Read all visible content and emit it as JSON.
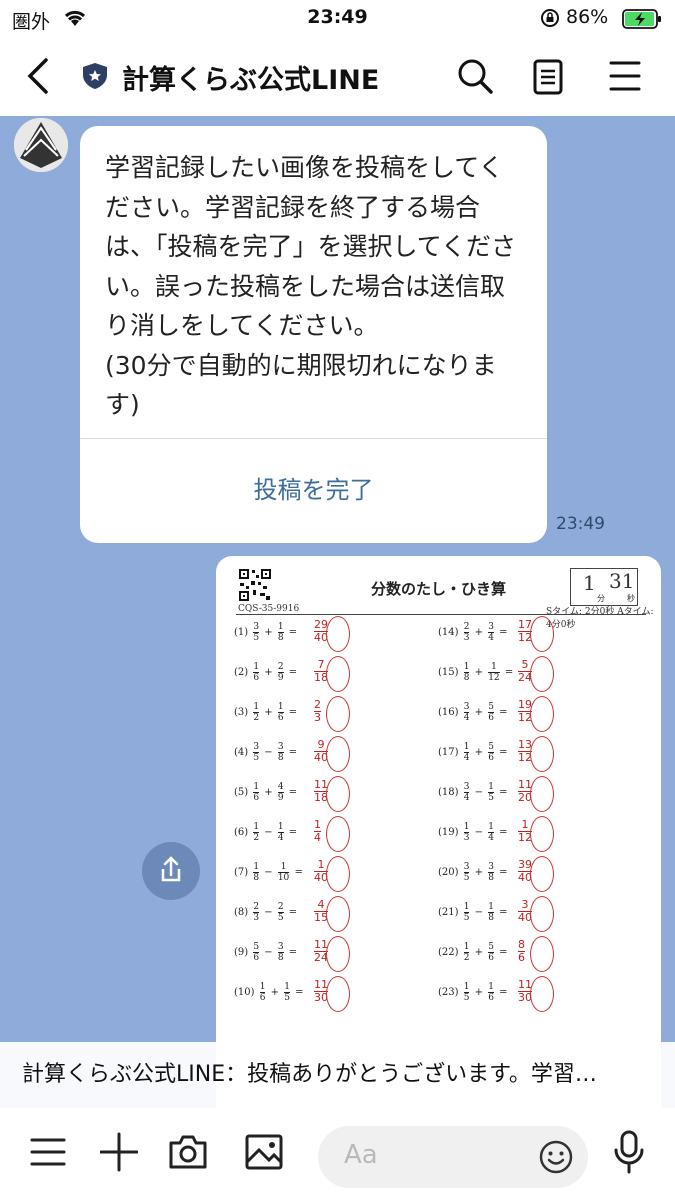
{
  "status": {
    "carrier": "圏外",
    "time": "23:49",
    "battery": "86%"
  },
  "header": {
    "title": "計算くらぶ公式LINE"
  },
  "message": {
    "text": "学習記録したい画像を投稿をしてください。学習記録を終了する場合は、「投稿を完了」を選択してください。誤った投稿をした場合は送信取り消しをしてください。\n(30分で自動的に期限切れになります)",
    "action_label": "投稿を完了",
    "time": "23:49"
  },
  "worksheet": {
    "title": "分数のたし・ひき算",
    "code": "CQS-35-9916",
    "meta": "Sタイム: 2分0秒  Aタイム: 4分0秒",
    "time_min": "1",
    "time_sec": "31",
    "min_label": "分",
    "sec_label": "秒",
    "left": [
      {
        "n": "(1)",
        "a": [
          "3",
          "5"
        ],
        "op": "+",
        "b": [
          "1",
          "8"
        ],
        "ans": [
          "29",
          "40"
        ]
      },
      {
        "n": "(2)",
        "a": [
          "1",
          "6"
        ],
        "op": "+",
        "b": [
          "2",
          "9"
        ],
        "ans": [
          "7",
          "18"
        ]
      },
      {
        "n": "(3)",
        "a": [
          "1",
          "2"
        ],
        "op": "+",
        "b": [
          "1",
          "6"
        ],
        "ans": [
          "2",
          "3"
        ]
      },
      {
        "n": "(4)",
        "a": [
          "3",
          "5"
        ],
        "op": "−",
        "b": [
          "3",
          "8"
        ],
        "ans": [
          "9",
          "40"
        ]
      },
      {
        "n": "(5)",
        "a": [
          "1",
          "6"
        ],
        "op": "+",
        "b": [
          "4",
          "9"
        ],
        "ans": [
          "11",
          "18"
        ]
      },
      {
        "n": "(6)",
        "a": [
          "1",
          "2"
        ],
        "op": "−",
        "b": [
          "1",
          "4"
        ],
        "ans": [
          "1",
          "4"
        ]
      },
      {
        "n": "(7)",
        "a": [
          "1",
          "8"
        ],
        "op": "−",
        "b": [
          "1",
          "10"
        ],
        "ans": [
          "1",
          "40"
        ]
      },
      {
        "n": "(8)",
        "a": [
          "2",
          "3"
        ],
        "op": "−",
        "b": [
          "2",
          "5"
        ],
        "ans": [
          "4",
          "15"
        ]
      },
      {
        "n": "(9)",
        "a": [
          "5",
          "6"
        ],
        "op": "−",
        "b": [
          "3",
          "8"
        ],
        "ans": [
          "11",
          "24"
        ]
      },
      {
        "n": "(10)",
        "a": [
          "1",
          "6"
        ],
        "op": "+",
        "b": [
          "1",
          "5"
        ],
        "ans": [
          "11",
          "30"
        ]
      }
    ],
    "right": [
      {
        "n": "(14)",
        "a": [
          "2",
          "3"
        ],
        "op": "+",
        "b": [
          "3",
          "4"
        ],
        "ans": [
          "17",
          "12"
        ]
      },
      {
        "n": "(15)",
        "a": [
          "1",
          "8"
        ],
        "op": "+",
        "b": [
          "1",
          "12"
        ],
        "ans": [
          "5",
          "24"
        ]
      },
      {
        "n": "(16)",
        "a": [
          "3",
          "4"
        ],
        "op": "+",
        "b": [
          "5",
          "6"
        ],
        "ans": [
          "19",
          "12"
        ]
      },
      {
        "n": "(17)",
        "a": [
          "1",
          "4"
        ],
        "op": "+",
        "b": [
          "5",
          "6"
        ],
        "ans": [
          "13",
          "12"
        ]
      },
      {
        "n": "(18)",
        "a": [
          "3",
          "4"
        ],
        "op": "−",
        "b": [
          "1",
          "5"
        ],
        "ans": [
          "11",
          "20"
        ]
      },
      {
        "n": "(19)",
        "a": [
          "1",
          "3"
        ],
        "op": "−",
        "b": [
          "1",
          "4"
        ],
        "ans": [
          "1",
          "12"
        ]
      },
      {
        "n": "(20)",
        "a": [
          "3",
          "5"
        ],
        "op": "+",
        "b": [
          "3",
          "8"
        ],
        "ans": [
          "39",
          "40"
        ]
      },
      {
        "n": "(21)",
        "a": [
          "1",
          "5"
        ],
        "op": "−",
        "b": [
          "1",
          "8"
        ],
        "ans": [
          "3",
          "40"
        ]
      },
      {
        "n": "(22)",
        "a": [
          "1",
          "2"
        ],
        "op": "+",
        "b": [
          "5",
          "6"
        ],
        "ans": [
          "8",
          "6"
        ]
      },
      {
        "n": "(23)",
        "a": [
          "1",
          "5"
        ],
        "op": "+",
        "b": [
          "1",
          "6"
        ],
        "ans": [
          "11",
          "30"
        ]
      }
    ]
  },
  "banner": {
    "text": "計算くらぶ公式LINE：投稿ありがとうございます。学習…"
  },
  "input": {
    "placeholder": "Aa"
  }
}
